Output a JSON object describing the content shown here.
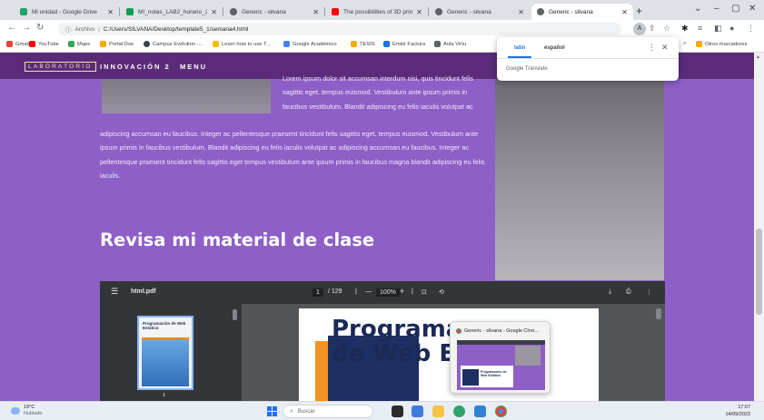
{
  "tabs": [
    {
      "title": "Mi unidad - Google Drive",
      "icon": "google-drive-icon",
      "color": "#1fa463"
    },
    {
      "title": "MI_notas_LAB2_horario_2023",
      "icon": "sheets-icon",
      "color": "#0f9d58"
    },
    {
      "title": "Generic - silvana",
      "icon": "globe-icon",
      "color": "#5f6368"
    },
    {
      "title": "The possibilities of 3D printin",
      "icon": "youtube-icon",
      "color": "#ff0000"
    },
    {
      "title": "Generic - silvana",
      "icon": "globe-icon",
      "color": "#5f6368"
    },
    {
      "title": "Generic - silvana",
      "icon": "globe-icon",
      "color": "#5f6368",
      "active": true
    }
  ],
  "window_controls": {
    "minimize": "–",
    "maximize": "▢",
    "close": "✕",
    "collapse": "⌄"
  },
  "address": {
    "scheme": "Archivo",
    "url": "C:/Users/SILVANA/Desktop/template5_1/semana4.html"
  },
  "bookmarks": [
    {
      "label": "Gmail",
      "color": "#ea4335"
    },
    {
      "label": "YouTube",
      "color": "#ff0000"
    },
    {
      "label": "Maps",
      "color": "#34a853"
    },
    {
      "label": "Portal Dse",
      "color": "#f9ab00"
    },
    {
      "label": "Campus Evolution -...",
      "color": "#3c4043"
    },
    {
      "label": "Learn how to use T...",
      "color": "#fbbc04"
    },
    {
      "label": "Google Académico",
      "color": "#4285f4"
    },
    {
      "label": "TESIS",
      "color": "#f9ab00"
    },
    {
      "label": "Emitir Factura",
      "color": "#1a73e8"
    },
    {
      "label": "Aula Virtu",
      "color": "#5f6368"
    }
  ],
  "bookmarks_overflow": "»",
  "other_bookmarks": "Otros marcadores",
  "translate_popup": {
    "lang_source": "latín",
    "lang_target": "español",
    "footer": "Google Translate"
  },
  "site": {
    "logo": "LABORATORIO",
    "nav": "INNOVACIÓN 2",
    "menu": "MENU",
    "para_right": "Lorem ipsum dolor sit accumsan interdum nisi, quis tincidunt felis sagittis eget. tempus euismod. Vestibulum ante ipsum primis in faucibus vestibulum. Blandit adipiscing eu felis iaculis volutpat ac",
    "para_full": "adipiscing accumsan eu faucibus. Integer ac pellentesque praesent tincidunt felis sagittis eget. tempus euismod. Vestibulum ante ipsum primis in faucibus vestibulum. Blandit adipiscing eu felis iaculis volutpat ac adipiscing accumsan eu faucibus. Integer ac pellentesque praesent tincidunt felis sagittis eget tempus vestibulum ante ipsum primis in faucibus magna blandit adipiscing eu felis iaculis.",
    "section_title": "Revisa mi material de clase"
  },
  "pdf": {
    "filename": "html.pdf",
    "page_current": "1",
    "page_total": "/ 129",
    "zoom": "100%",
    "thumb_title": "Programación de Web Estático",
    "thumb_page": "1",
    "page_heading_line1": "Programa",
    "page_heading_line2": "de Web Es"
  },
  "preview": {
    "title": "Generic - silvana - Google Chro...",
    "mini_text": "Programación de Web Estático"
  },
  "taskbar": {
    "temperature": "19°C",
    "weather": "Nublado",
    "search_placeholder": "Buscar",
    "time": "17:07",
    "date": "14/09/2023"
  }
}
